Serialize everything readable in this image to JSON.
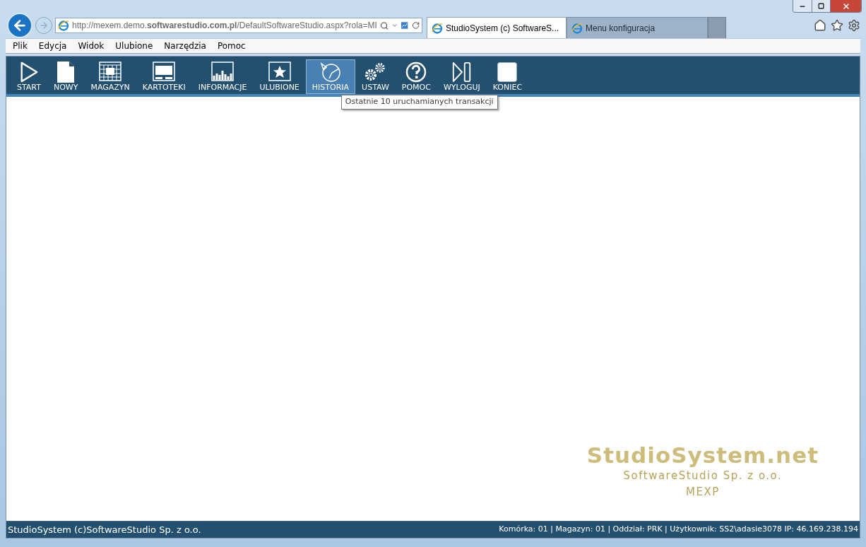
{
  "browser": {
    "address": "http://mexem.demo.**softwarestudio.com.pl**/DefaultSoftwareStudio.aspx?rola=MI",
    "tabs": [
      {
        "title": "StudioSystem (c) SoftwareS...",
        "selected": true
      },
      {
        "title": "Menu konfiguracja",
        "selected": false
      }
    ],
    "menu": [
      "Plik",
      "Edycja",
      "Widok",
      "Ulubione",
      "Narzędzia",
      "Pomoc"
    ]
  },
  "toolbar": [
    {
      "label": "START",
      "kind": "start",
      "selected": false
    },
    {
      "label": "NOWY",
      "kind": "new",
      "selected": false
    },
    {
      "label": "MAGAZYN",
      "kind": "grid",
      "selected": false
    },
    {
      "label": "KARTOTEKI",
      "kind": "cards",
      "selected": false
    },
    {
      "label": "INFORMACJE",
      "kind": "chart",
      "selected": false
    },
    {
      "label": "ULUBIONE",
      "kind": "star",
      "selected": false
    },
    {
      "label": "HISTORIA",
      "kind": "history",
      "selected": true,
      "tooltip": "Ostatnie 10 uruchamianych transakcji"
    },
    {
      "label": "USTAW",
      "kind": "gears",
      "selected": false
    },
    {
      "label": "POMOC",
      "kind": "help",
      "selected": false
    },
    {
      "label": "WYLOGUJ",
      "kind": "logout",
      "selected": false
    },
    {
      "label": "KONIEC",
      "kind": "stop",
      "selected": false
    }
  ],
  "brand": {
    "title": "StudioSystem.net",
    "company": "SoftwareStudio Sp. z o.o.",
    "code": "MEXP"
  },
  "status_bar": {
    "left": "StudioSystem (c)SoftwareStudio Sp. z o.o.",
    "right": "Komórka: 01 | Magazyn: 01 | Oddział: PRK | Użytkownik: SS2\\adasie3078 IP: 46.169.238.194"
  }
}
